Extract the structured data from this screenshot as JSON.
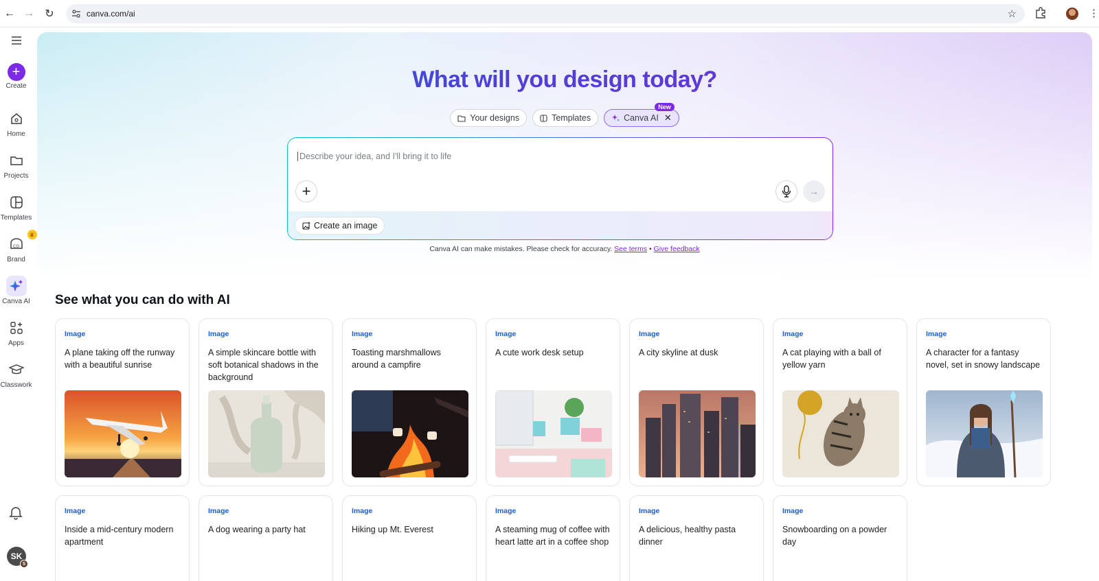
{
  "browser": {
    "url": "canva.com/ai"
  },
  "sidebar": {
    "items": [
      {
        "label": "Create"
      },
      {
        "label": "Home"
      },
      {
        "label": "Projects"
      },
      {
        "label": "Templates"
      },
      {
        "label": "Brand"
      },
      {
        "label": "Canva AI"
      },
      {
        "label": "Apps"
      },
      {
        "label": "Classwork"
      }
    ],
    "avatar_initials": "SK",
    "avatar_badge": "S"
  },
  "hero": {
    "title": "What will you design today?",
    "tabs": [
      {
        "label": "Your designs"
      },
      {
        "label": "Templates"
      },
      {
        "label": "Canva AI",
        "badge": "New"
      }
    ]
  },
  "prompt": {
    "placeholder": "Describe your idea, and I'll bring it to life",
    "create_image_label": "Create an image"
  },
  "disclaimer": {
    "text": "Canva AI can make mistakes. Please check for accuracy.",
    "terms_link": "See terms",
    "separator": "•",
    "feedback_link": "Give feedback"
  },
  "section": {
    "title": "See what you can do with AI",
    "cards": [
      {
        "tag": "Image",
        "text": "A plane taking off the runway with a beautiful sunrise"
      },
      {
        "tag": "Image",
        "text": "A simple skincare bottle with soft botanical shadows in the background"
      },
      {
        "tag": "Image",
        "text": "Toasting marshmallows around a campfire"
      },
      {
        "tag": "Image",
        "text": "A cute work desk setup"
      },
      {
        "tag": "Image",
        "text": "A city skyline at dusk"
      },
      {
        "tag": "Image",
        "text": "A cat playing with a ball of yellow yarn"
      },
      {
        "tag": "Image",
        "text": "A character for a fantasy novel, set in snowy landscape"
      },
      {
        "tag": "Image",
        "text": "Inside a mid-century modern apartment"
      },
      {
        "tag": "Image",
        "text": "A dog wearing a party hat"
      },
      {
        "tag": "Image",
        "text": "Hiking up Mt. Everest"
      },
      {
        "tag": "Image",
        "text": "A steaming mug of coffee with heart latte art in a coffee shop"
      },
      {
        "tag": "Image",
        "text": "A delicious, healthy pasta dinner"
      },
      {
        "tag": "Image",
        "text": "Snowboarding on a powder day"
      }
    ]
  },
  "colors": {
    "brand_purple": "#7d2ae8",
    "tag_blue": "#1a5bd6",
    "teal": "#00c4cc"
  }
}
